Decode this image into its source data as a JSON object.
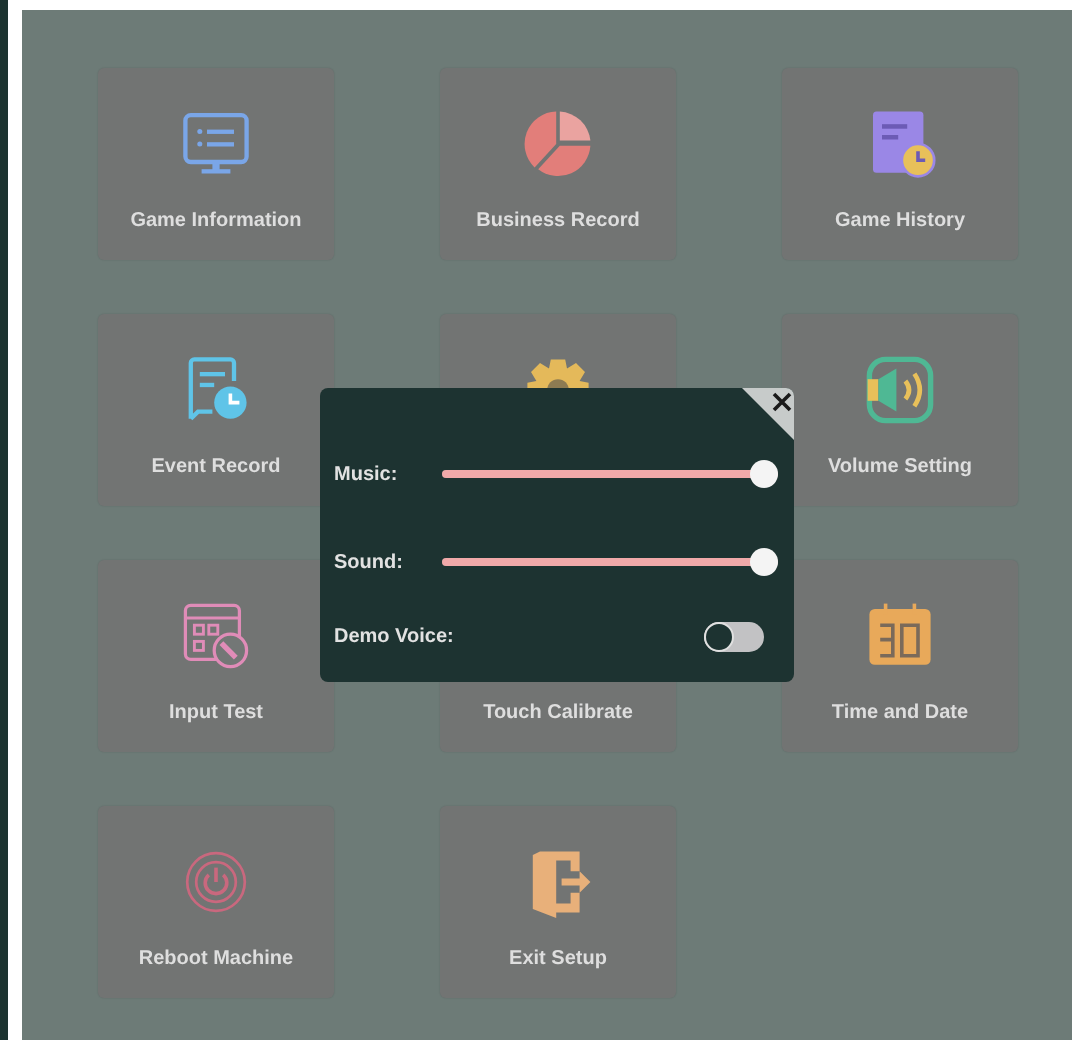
{
  "tiles": [
    {
      "kind": "tile",
      "label": "Game Information"
    },
    {
      "kind": "tile",
      "label": "Business Record"
    },
    {
      "kind": "tile",
      "label": "Game History"
    },
    {
      "kind": "tile",
      "label": "Event Record"
    },
    {
      "kind": "tile"
    },
    {
      "kind": "tile",
      "label": "Volume Setting"
    },
    {
      "kind": "tile",
      "label": "Input Test"
    },
    {
      "kind": "tile",
      "label": "Touch Calibrate"
    },
    {
      "kind": "tile",
      "label": "Time and Date"
    },
    {
      "kind": "tile",
      "label": "Reboot Machine"
    },
    {
      "kind": "tile",
      "label": "Exit Setup"
    }
  ],
  "dialog": {
    "settings": [
      {
        "kind": "slider",
        "label": "Music:",
        "level": 1
      },
      {
        "kind": "slider",
        "label": "Sound:",
        "level": 1
      },
      {
        "kind": "toggle",
        "label": "Demo Voice:",
        "on": false
      }
    ]
  }
}
